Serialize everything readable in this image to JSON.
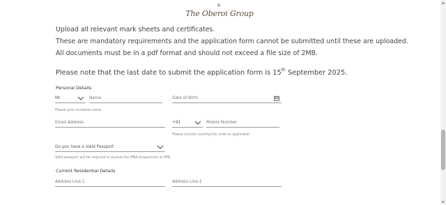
{
  "brand": {
    "logo_text": "The Oberoi Group",
    "crest_icon": "crest-icon"
  },
  "notice": {
    "line1": "Upload all relevant mark sheets and certificates.",
    "line2": "These are mandatory requirements and the application form cannot be submitted until these are uploaded.",
    "line3": "All documents must be in a pdf format and should not exceed a file size of 2MB.",
    "deadline_prefix": "Please note that the last date to submit the application form is 15",
    "deadline_sup": "th",
    "deadline_suffix": " September 2025."
  },
  "personal": {
    "heading": "Personal Details",
    "title_value": "Mr.",
    "name_placeholder": "Name",
    "name_hint": "Please give complete name",
    "dob_placeholder": "Date of Birth",
    "email_placeholder": "Email Address",
    "country_code": "+91",
    "mobile_placeholder": "Mobile Number",
    "mobile_hint": "Please include country/city code as applicable",
    "passport_placeholder": "Do you have a Valid Passport",
    "passport_hint": "Valid passport will be required to pursue the MBA programme at EML"
  },
  "address": {
    "heading": "Current Residential Details",
    "line1_placeholder": "Address Line 1",
    "line2_placeholder": "Address Line 2"
  },
  "scroll": {
    "position_fraction": 0.72
  }
}
